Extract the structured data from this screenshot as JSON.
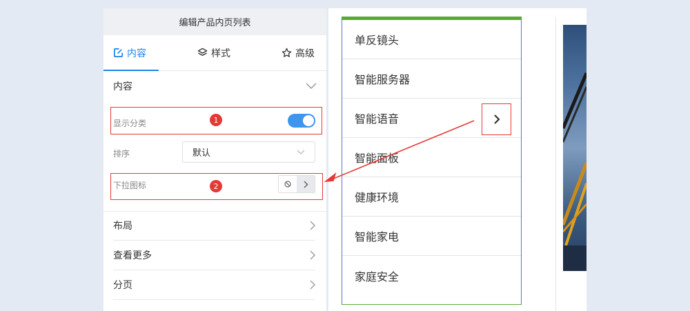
{
  "panel": {
    "title": "编辑产品内页列表",
    "tabs": [
      {
        "label": "内容",
        "icon": "edit-icon",
        "active": true
      },
      {
        "label": "样式",
        "icon": "layers-icon",
        "active": false
      },
      {
        "label": "高级",
        "icon": "settings-star-icon",
        "active": false
      }
    ],
    "content_section": {
      "label": "内容"
    },
    "show_category": {
      "label": "显示分类",
      "enabled": true,
      "badge": "1"
    },
    "sort": {
      "label": "排序",
      "value": "默认"
    },
    "dropdown_icon": {
      "label": "下拉图标",
      "badge": "2"
    },
    "sections": [
      {
        "label": "布局"
      },
      {
        "label": "查看更多"
      },
      {
        "label": "分页"
      }
    ]
  },
  "preview": {
    "menu_items": [
      "单反镜头",
      "智能服务器",
      "智能语音",
      "智能面板",
      "健康环境",
      "智能家电",
      "家庭安全"
    ]
  },
  "colors": {
    "accent": "#1b83e8",
    "annotation_red": "#e53935",
    "menu_border_green": "#5aa935"
  }
}
